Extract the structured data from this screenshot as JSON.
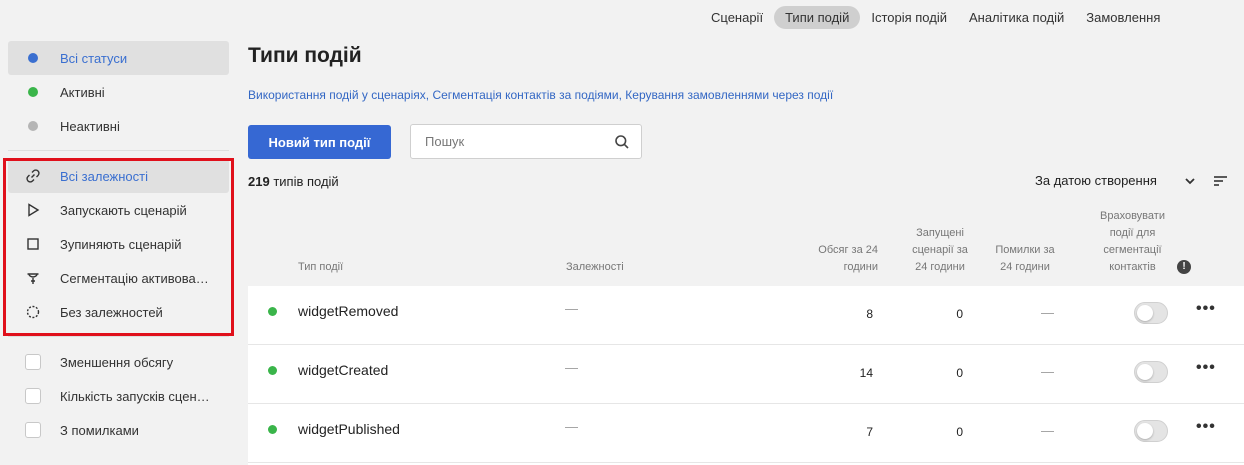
{
  "topnav": {
    "tabs": [
      {
        "label": "Сценарії",
        "active": false
      },
      {
        "label": "Типи подій",
        "active": true
      },
      {
        "label": "Історія подій",
        "active": false
      },
      {
        "label": "Аналітика подій",
        "active": false
      },
      {
        "label": "Замовлення",
        "active": false
      }
    ]
  },
  "sidebar": {
    "statuses": [
      {
        "label": "Всі статуси",
        "color": "#3a6fd0",
        "active": true
      },
      {
        "label": "Активні",
        "color": "#3ab54a",
        "active": false
      },
      {
        "label": "Неактивні",
        "color": "#b5b5b5",
        "active": false
      }
    ],
    "dependencies": [
      {
        "label": "Всі залежності",
        "icon": "link-icon",
        "active": true
      },
      {
        "label": "Запускають сценарій",
        "icon": "play-icon",
        "active": false
      },
      {
        "label": "Зупиняють сценарій",
        "icon": "stop-icon",
        "active": false
      },
      {
        "label": "Сегментацію активовано",
        "icon": "filter-icon",
        "active": false
      },
      {
        "label": "Без залежностей",
        "icon": "broken-link-icon",
        "active": false
      }
    ],
    "checks": [
      {
        "label": "Зменшення обсягу"
      },
      {
        "label": "Кількість запусків сценаріїв"
      },
      {
        "label": "З помилками"
      }
    ]
  },
  "main": {
    "title": "Типи подій",
    "links": [
      "Використання подій у сценаріях",
      "Сегментація контактів за подіями",
      "Керування замовленнями через події"
    ],
    "link_separator": ", ",
    "new_button": "Новий тип події",
    "search_placeholder": "Пошук",
    "count_number": "219",
    "count_text": " типів подій",
    "sort_label": "За датою створення"
  },
  "table": {
    "headers": {
      "type": "Тип події",
      "deps": "Залежності",
      "volume": "Обсяг за 24\nгодини",
      "scenarios": "Запущені\nсценарії за\n24 години",
      "errors": "Помилки за\n24 години",
      "segmentation": "Враховувати\nподії для\nсегментації\nконтактів"
    },
    "rows": [
      {
        "name": "widgetRemoved",
        "deps": "—",
        "volume": "8",
        "scenarios": "0",
        "errors": "—",
        "active_color": "#3ab54a"
      },
      {
        "name": "widgetCreated",
        "deps": "—",
        "volume": "14",
        "scenarios": "0",
        "errors": "—",
        "active_color": "#3ab54a"
      },
      {
        "name": "widgetPublished",
        "deps": "—",
        "volume": "7",
        "scenarios": "0",
        "errors": "—",
        "active_color": "#3ab54a"
      }
    ]
  }
}
